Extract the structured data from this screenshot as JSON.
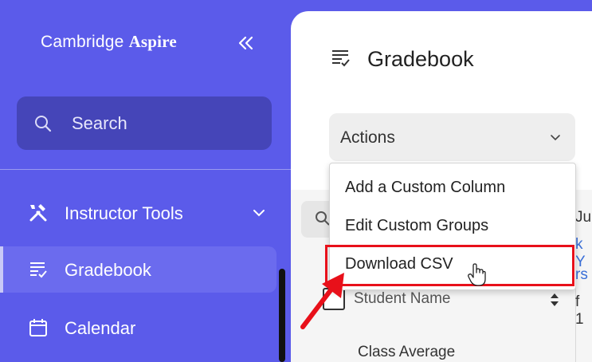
{
  "sidebar": {
    "brand_prefix": "Cambridge",
    "brand_suffix": "Aspire",
    "search_label": "Search",
    "items": [
      {
        "label": "Instructor Tools",
        "icon": "tools-icon"
      },
      {
        "label": "Gradebook",
        "icon": "gradebook-icon"
      },
      {
        "label": "Calendar",
        "icon": "calendar-icon"
      }
    ]
  },
  "main": {
    "title": "Gradebook",
    "actions_label": "Actions",
    "menu": [
      {
        "label": "Add a Custom Column"
      },
      {
        "label": "Edit Custom Groups"
      },
      {
        "label": "Download CSV"
      }
    ],
    "table": {
      "student_name_header": "Student Name",
      "class_average": "Class Average",
      "cut_off_column": [
        "Ju",
        "k Y",
        "rs",
        "f 1"
      ]
    }
  },
  "colors": {
    "sidebar_bg": "#5b5bea",
    "search_bg": "#4545b8",
    "highlight": "#e8101a",
    "link": "#3a6fd8"
  }
}
